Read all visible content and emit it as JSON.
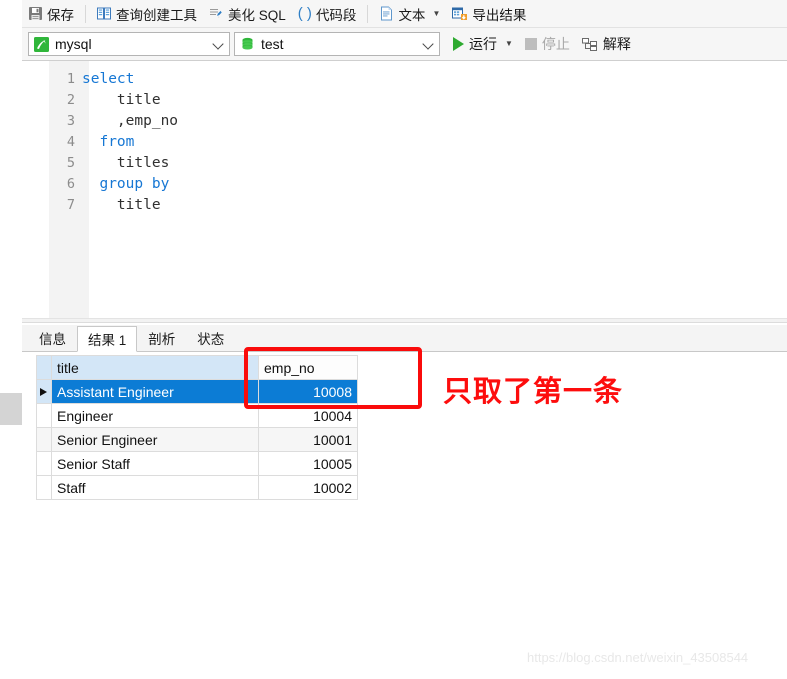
{
  "toolbar": {
    "items": [
      {
        "label": "保存",
        "icon": "save-icon"
      },
      {
        "label": "查询创建工具",
        "icon": "query-builder-icon"
      },
      {
        "label": "美化 SQL",
        "icon": "beautify-sql-icon"
      },
      {
        "label": "代码段",
        "icon": "code-snippet-icon"
      },
      {
        "label": "文本",
        "icon": "text-icon"
      },
      {
        "label": "导出结果",
        "icon": "export-result-icon"
      }
    ]
  },
  "connbar": {
    "connection": {
      "value": "mysql",
      "icon": "mysql-icon"
    },
    "database": {
      "value": "test",
      "icon": "database-icon"
    },
    "run_label": "运行",
    "stop_label": "停止",
    "explain_label": "解释"
  },
  "editor": {
    "lines": [
      {
        "no": "1",
        "indent": "",
        "keyword": "select",
        "text": ""
      },
      {
        "no": "2",
        "indent": "    ",
        "keyword": "",
        "text": "title"
      },
      {
        "no": "3",
        "indent": "    ",
        "keyword": "",
        "text": ",emp_no"
      },
      {
        "no": "4",
        "indent": "  ",
        "keyword": "from",
        "text": ""
      },
      {
        "no": "5",
        "indent": "    ",
        "keyword": "",
        "text": "titles"
      },
      {
        "no": "6",
        "indent": "  ",
        "keyword": "group by",
        "text": ""
      },
      {
        "no": "7",
        "indent": "    ",
        "keyword": "",
        "text": "title"
      }
    ]
  },
  "result_tabs": [
    {
      "label": "信息",
      "active": false
    },
    {
      "label": "结果 1",
      "active": true
    },
    {
      "label": "剖析",
      "active": false
    },
    {
      "label": "状态",
      "active": false
    }
  ],
  "grid": {
    "columns": [
      "title",
      "emp_no"
    ],
    "rows": [
      {
        "title": "Assistant Engineer",
        "emp_no": "10008",
        "selected": true
      },
      {
        "title": "Engineer",
        "emp_no": "10004",
        "selected": false
      },
      {
        "title": "Senior Engineer",
        "emp_no": "10001",
        "selected": false
      },
      {
        "title": "Senior Staff",
        "emp_no": "10005",
        "selected": false
      },
      {
        "title": "Staff",
        "emp_no": "10002",
        "selected": false
      }
    ]
  },
  "annotation": {
    "text": "只取了第一条",
    "color": "#fd0d0d"
  },
  "watermark": {
    "text": "https://blog.csdn.net/weixin_43508544"
  }
}
